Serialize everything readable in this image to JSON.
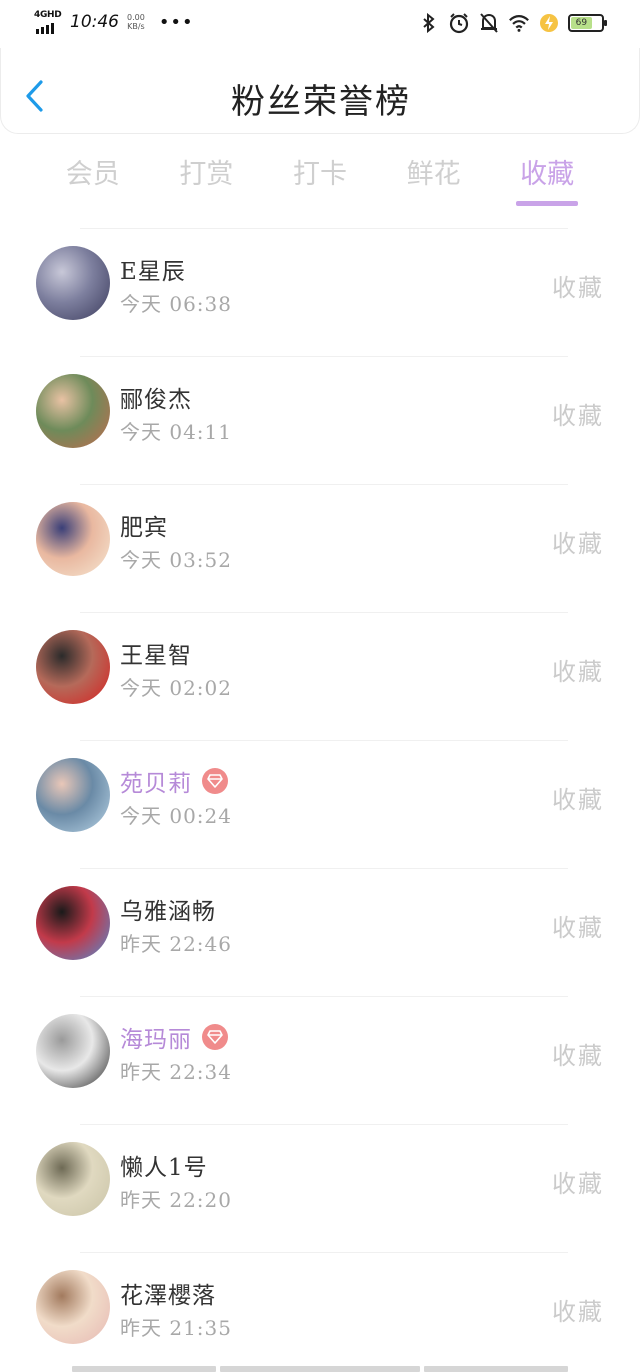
{
  "status_bar": {
    "network": "4GHD",
    "time": "10:46",
    "speed_value": "0.00",
    "speed_unit": "KB/s",
    "dots": "•••",
    "battery": "69"
  },
  "header": {
    "title": "粉丝荣誉榜"
  },
  "tabs": [
    {
      "label": "会员",
      "active": false
    },
    {
      "label": "打赏",
      "active": false
    },
    {
      "label": "打卡",
      "active": false
    },
    {
      "label": "鲜花",
      "active": false
    },
    {
      "label": "收藏",
      "active": true
    }
  ],
  "fans": [
    {
      "name": "E星辰",
      "time": "今天 06:38",
      "action": "收藏",
      "vip": false,
      "avatar_colors": [
        "#3b3b5c",
        "#c8c8d8",
        "#7d7f9e"
      ]
    },
    {
      "name": "郦俊杰",
      "time": "今天 04:11",
      "action": "收藏",
      "vip": false,
      "avatar_colors": [
        "#c46a4e",
        "#e9c2a4",
        "#6e8b5a"
      ]
    },
    {
      "name": "肥宾",
      "time": "今天 03:52",
      "action": "收藏",
      "vip": false,
      "avatar_colors": [
        "#f6e7d2",
        "#3a3f78",
        "#e9b8a0"
      ]
    },
    {
      "name": "王星智",
      "time": "今天 02:02",
      "action": "收藏",
      "vip": false,
      "avatar_colors": [
        "#d81f1f",
        "#2b2b2b",
        "#b56a5a"
      ]
    },
    {
      "name": "苑贝莉",
      "time": "今天 00:24",
      "action": "收藏",
      "vip": true,
      "avatar_colors": [
        "#b9d4e6",
        "#e9c7b8",
        "#6a8aa6"
      ]
    },
    {
      "name": "乌雅涵畅",
      "time": "昨天 22:46",
      "action": "收藏",
      "vip": false,
      "avatar_colors": [
        "#4c8fd6",
        "#1a1a1a",
        "#c23a4a"
      ]
    },
    {
      "name": "海玛丽",
      "time": "昨天 22:34",
      "action": "收藏",
      "vip": true,
      "avatar_colors": [
        "#2a2a2a",
        "#9a9a9a",
        "#e8e8e8"
      ]
    },
    {
      "name": "懒人1号",
      "time": "昨天 22:20",
      "action": "收藏",
      "vip": false,
      "avatar_colors": [
        "#c9c3a6",
        "#6e6a55",
        "#e0d9c0"
      ]
    },
    {
      "name": "花澤櫻落",
      "time": "昨天 21:35",
      "action": "收藏",
      "vip": false,
      "avatar_colors": [
        "#e6b7b2",
        "#a27a5e",
        "#f1dcc9"
      ]
    }
  ],
  "colors": {
    "accent": "#c9a3e8",
    "vip_name": "#b68ad8",
    "vip_badge": "#f08b8b",
    "back_arrow": "#1e9be9"
  }
}
